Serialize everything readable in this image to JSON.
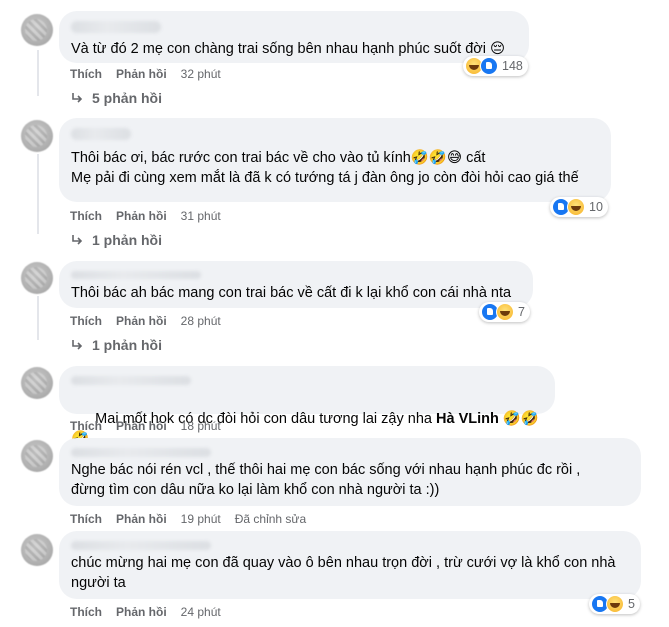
{
  "labels": {
    "like": "Thích",
    "reply": "Phản hồi"
  },
  "comments": [
    {
      "text": "Và từ đó 2 mẹ con chàng trai sống bên nhau hạnh phúc suốt đời 😔",
      "time": "32 phút",
      "reactions": {
        "icons": [
          "haha",
          "like"
        ],
        "count": "148"
      },
      "replies": "5 phản hồi"
    },
    {
      "text_line1": "Thôi bác ơi, bác rước con trai bác về cho vào tủ kính🤣🤣😅 cất",
      "text_line2": "Mẹ pải đi cùng xem mắt là đã k có tướng tá j đàn ông jo còn đòi hỏi cao giá thế",
      "time": "31 phút",
      "reactions": {
        "icons": [
          "like",
          "haha"
        ],
        "count": "10"
      },
      "replies": "1 phản hồi"
    },
    {
      "text": "Thôi bác ah bác mang con trai bác về cất đi k lại khổ con cái nhà nta",
      "time": "28 phút",
      "reactions": {
        "icons": [
          "like",
          "haha"
        ],
        "count": "7"
      },
      "replies": "1 phản hồi"
    },
    {
      "text_before": "Mai mốt hok có dc đòi hỏi con dâu tương lai zậy nha ",
      "mention": "Hà VLinh",
      "text_after": " 🤣🤣🤣",
      "time": "18 phút"
    },
    {
      "text_line1": "Nghe bác nói rén vcl , thế thôi hai mẹ con bác sống với nhau hạnh phúc đc rồi ,",
      "text_line2": "đừng tìm con dâu nữa ko lại làm khổ con nhà người ta :))",
      "time": "19 phút",
      "edited": "Đã chỉnh sửa"
    },
    {
      "text_line1": "chúc mừng hai mẹ con đã quay vào ô bên nhau trọn đời , trừ cưới vợ là khổ con nhà",
      "text_line2": "người ta",
      "time": "24 phút",
      "reactions": {
        "icons": [
          "like",
          "haha"
        ],
        "count": "5"
      }
    }
  ]
}
